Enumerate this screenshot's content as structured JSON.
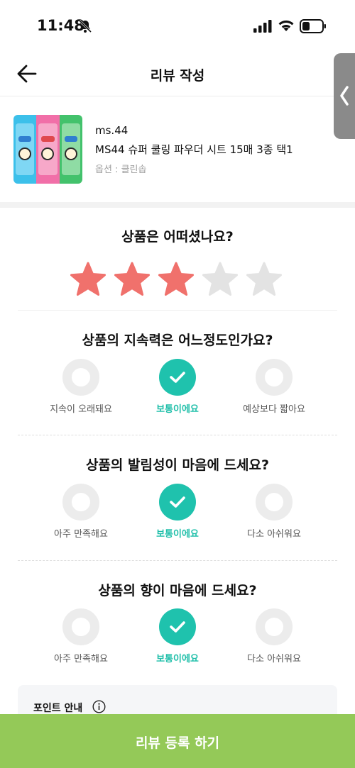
{
  "status_bar": {
    "time": "11:48"
  },
  "header": {
    "title": "리뷰 작성"
  },
  "product": {
    "brand": "ms.44",
    "name": "MS44 슈퍼 쿨링 파우더 시트 15매 3종 택1",
    "option": "옵션 : 클린솝",
    "image_strips": [
      "#3cc0ea",
      "#f16fa8",
      "#43c26c"
    ]
  },
  "rating": {
    "question": "상품은 어떠셨나요?",
    "value": 3,
    "max": 5,
    "filled_color": "#f0716c",
    "empty_color": "#e3e3e3"
  },
  "questions": [
    {
      "title": "상품의 지속력은 어느정도인가요?",
      "options": [
        "지속이 오래돼요",
        "보통이에요",
        "예상보다 짧아요"
      ],
      "selected": 1
    },
    {
      "title": "상품의 발림성이 마음에 드세요?",
      "options": [
        "아주 만족해요",
        "보통이에요",
        "다소 아쉬워요"
      ],
      "selected": 1
    },
    {
      "title": "상품의 향이 마음에 드세요?",
      "options": [
        "아주 만족해요",
        "보통이에요",
        "다소 아쉬워요"
      ],
      "selected": 1
    }
  ],
  "point_info": {
    "title": "포인트 안내"
  },
  "submit": {
    "label": "리뷰 등록 하기"
  },
  "colors": {
    "accent": "#1fc2ad",
    "submit": "#94c958",
    "star": "#f0716c"
  }
}
